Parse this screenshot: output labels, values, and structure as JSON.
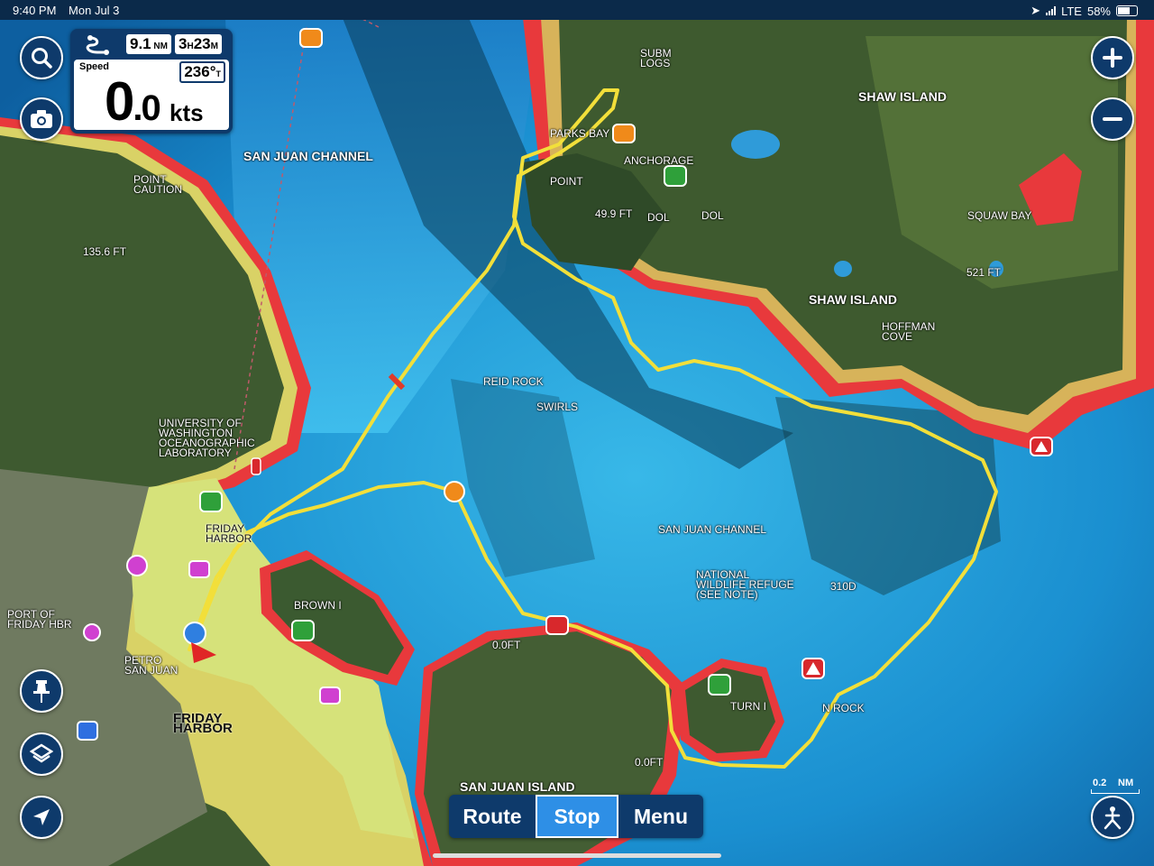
{
  "status_bar": {
    "time": "9:40 PM",
    "date": "Mon Jul 3",
    "network": "LTE",
    "battery": "58%"
  },
  "instrument": {
    "distance_value": "9.1",
    "distance_unit": "NM",
    "eta_hours": "3",
    "eta_h_unit": "H",
    "eta_minutes": "23",
    "eta_m_unit": "M",
    "speed_label": "Speed",
    "speed_int": "0",
    "speed_dec": ".0",
    "speed_unit": "kts",
    "heading": "236°",
    "heading_ref": "T"
  },
  "buttons": {
    "search": "search-icon",
    "camera": "camera-icon",
    "zoom_in": "plus-icon",
    "zoom_out": "minus-icon",
    "pin": "pin-icon",
    "layers": "layers-icon",
    "locate": "navigation-arrow-icon",
    "autopilot": "anchor-person-icon"
  },
  "bottom_bar": {
    "route": "Route",
    "stop": "Stop",
    "menu": "Menu"
  },
  "scale": {
    "value": "0.2",
    "unit": "NM"
  },
  "map_labels": [
    {
      "id": "san-juan-channel-n",
      "text": "SAN JUAN CHANNEL",
      "cls": "big"
    },
    {
      "id": "shaw-island-1",
      "text": "SHAW ISLAND",
      "cls": "big"
    },
    {
      "id": "shaw-island-2",
      "text": "SHAW ISLAND",
      "cls": "big"
    },
    {
      "id": "parks-bay",
      "text": "PARKS BAY",
      "cls": ""
    },
    {
      "id": "anchorage",
      "text": "ANCHORAGE",
      "cls": ""
    },
    {
      "id": "point",
      "text": "POINT",
      "cls": ""
    },
    {
      "id": "squaw-bay",
      "text": "SQUAW BAY",
      "cls": ""
    },
    {
      "id": "hoffman-cove",
      "text": "HOFFMAN\nCOVE",
      "cls": ""
    },
    {
      "id": "point-caution",
      "text": "POINT\nCAUTION",
      "cls": ""
    },
    {
      "id": "uw-lab",
      "text": "UNIVERSITY OF\nWASHINGTON\nOCEANOGRAPHIC\nLABORATORY",
      "cls": ""
    },
    {
      "id": "friday-harbor-small",
      "text": "FRIDAY\nHARBOR",
      "cls": "dark"
    },
    {
      "id": "port-friday",
      "text": "PORT OF\nFRIDAY HBR",
      "cls": ""
    },
    {
      "id": "petro",
      "text": "PETRO\nSAN JUAN",
      "cls": ""
    },
    {
      "id": "friday-harbor-town",
      "text": "FRIDAY\nHARBOR",
      "cls": "town"
    },
    {
      "id": "brown-i",
      "text": "BROWN I",
      "cls": ""
    },
    {
      "id": "reid-rock",
      "text": "REID ROCK",
      "cls": ""
    },
    {
      "id": "swirls",
      "text": "SWIRLS",
      "cls": ""
    },
    {
      "id": "san-juan-channel-s",
      "text": "SAN JUAN CHANNEL",
      "cls": ""
    },
    {
      "id": "national-wildlife",
      "text": "NATIONAL\nWILDLIFE REFUGE\n(SEE NOTE)",
      "cls": ""
    },
    {
      "id": "turn-i",
      "text": "TURN I",
      "cls": ""
    },
    {
      "id": "turn-rock",
      "text": "N ROCK",
      "cls": ""
    },
    {
      "id": "san-juan-island",
      "text": "SAN JUAN ISLAND",
      "cls": "big"
    },
    {
      "id": "subm-logs",
      "text": "SUBM\nLOGS",
      "cls": ""
    },
    {
      "id": "depth-1",
      "text": "49.9 FT",
      "cls": ""
    },
    {
      "id": "depth-2",
      "text": "521 FT",
      "cls": ""
    },
    {
      "id": "depth-3",
      "text": "135.6 FT",
      "cls": ""
    },
    {
      "id": "depth-4",
      "text": "310D",
      "cls": ""
    },
    {
      "id": "depth-5",
      "text": "0.0FT",
      "cls": ""
    },
    {
      "id": "depth-6",
      "text": "0.0FT",
      "cls": ""
    },
    {
      "id": "dol-1",
      "text": "DOL",
      "cls": ""
    },
    {
      "id": "dol-2",
      "text": "DOL",
      "cls": ""
    }
  ]
}
